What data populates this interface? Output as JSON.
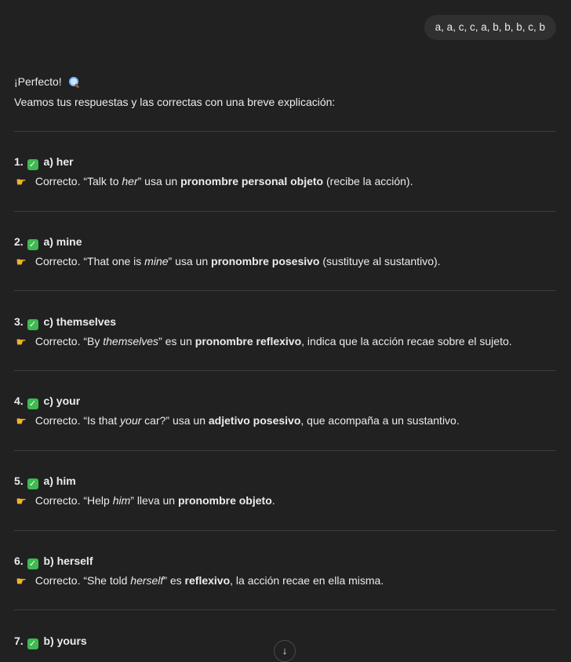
{
  "user_message": "a, a, c, c, a, b, b, b, c, b",
  "intro": {
    "line1": "¡Perfecto!",
    "line1_icon": "magnifier-icon",
    "line2": "Veamos tus respuestas y las correctas con una breve explicación:"
  },
  "items": [
    {
      "num": "1.",
      "answer": "a) her",
      "p1": " Correcto. “Talk to ",
      "p2": "her",
      "p3": "” usa un ",
      "p4": "pronombre personal objeto",
      "p5": " (recibe la acción)."
    },
    {
      "num": "2.",
      "answer": "a) mine",
      "p1": " Correcto. “That one is ",
      "p2": "mine",
      "p3": "” usa un ",
      "p4": "pronombre posesivo",
      "p5": " (sustituye al sustantivo)."
    },
    {
      "num": "3.",
      "answer": "c) themselves",
      "p1": " Correcto. “By ",
      "p2": "themselves",
      "p3": "” es un ",
      "p4": "pronombre reflexivo",
      "p5": ", indica que la acción recae sobre el sujeto."
    },
    {
      "num": "4.",
      "answer": "c) your",
      "p1": " Correcto. “Is that ",
      "p2": "your",
      "p3": " car?” usa un ",
      "p4": "adjetivo posesivo",
      "p5": ", que acompaña a un sustantivo."
    },
    {
      "num": "5.",
      "answer": "a) him",
      "p1": " Correcto. “Help ",
      "p2": "him",
      "p3": "” lleva un ",
      "p4": "pronombre objeto",
      "p5": "."
    },
    {
      "num": "6.",
      "answer": "b) herself",
      "p1": " Correcto. “She told ",
      "p2": "herself",
      "p3": "” es ",
      "p4": "reflexivo",
      "p5": ", la acción recae en ella misma."
    },
    {
      "num": "7.",
      "answer": "b) yours"
    }
  ],
  "check_icon": "check-mark-button-icon",
  "point_icon": "pointing-hand-icon",
  "scroll_button": "arrow-down-icon",
  "colors": {
    "background": "#212121",
    "bubble": "#303030",
    "check": "#3fb950",
    "text": "#ececec"
  }
}
